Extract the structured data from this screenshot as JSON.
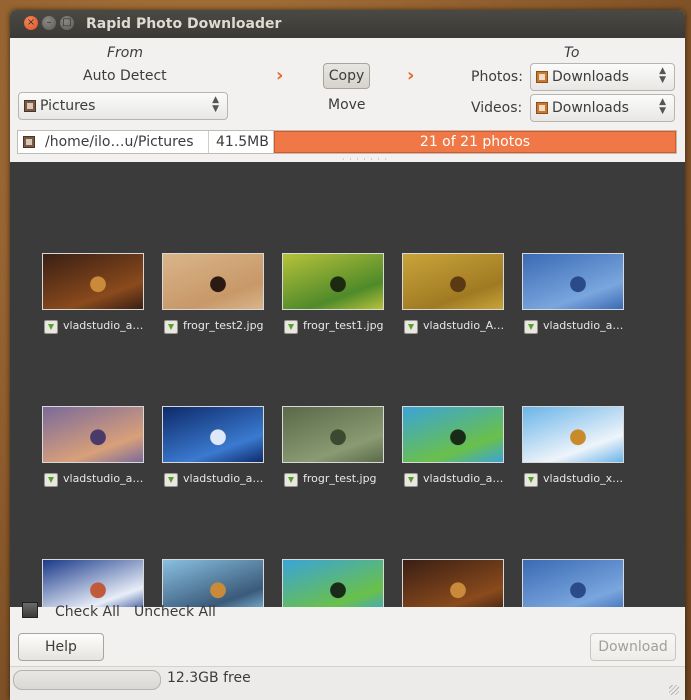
{
  "window": {
    "title": "Rapid Photo Downloader"
  },
  "source": {
    "from_label": "From",
    "auto_detect": "Auto Detect",
    "selected": "Pictures",
    "path": "/home/ilo…u/Pictures",
    "size": "41.5MB"
  },
  "transfer": {
    "copy_label": "Copy",
    "move_label": "Move",
    "arrow": "›"
  },
  "destination": {
    "to_label": "To",
    "photos_label": "Photos:",
    "photos_value": "Downloads",
    "videos_label": "Videos:",
    "videos_value": "Downloads"
  },
  "progress": {
    "label": "21 of 21 photos",
    "fraction": 1.0
  },
  "thumbnails": [
    {
      "name": "vladstudio_a…",
      "colors": [
        "#3a1f14",
        "#8a4a1c",
        "#c98a3a"
      ]
    },
    {
      "name": "frogr_test2.jpg",
      "colors": [
        "#d9b58a",
        "#c89868",
        "#2a1a12"
      ]
    },
    {
      "name": "frogr_test1.jpg",
      "colors": [
        "#b7c23a",
        "#4f8a2a",
        "#1c2a10"
      ]
    },
    {
      "name": "vladstudio_A…",
      "colors": [
        "#c9a43a",
        "#a07a22",
        "#5a3a12"
      ]
    },
    {
      "name": "vladstudio_a…",
      "colors": [
        "#3a6ab4",
        "#7aa6de",
        "#2a4a8a"
      ]
    },
    {
      "name": "vladstudio_a…",
      "colors": [
        "#7a6a9a",
        "#d9a07a",
        "#4a3a6a"
      ]
    },
    {
      "name": "vladstudio_a…",
      "colors": [
        "#0e2a6a",
        "#3a7ad0",
        "#dfe8f8"
      ]
    },
    {
      "name": "frogr_test.jpg",
      "colors": [
        "#5a6a4a",
        "#8a9a72",
        "#3a4a30"
      ]
    },
    {
      "name": "vladstudio_a…",
      "colors": [
        "#3aa4d8",
        "#6ac04a",
        "#1a2a18"
      ]
    },
    {
      "name": "vladstudio_x…",
      "colors": [
        "#6ab4e8",
        "#eef4fa",
        "#c98a2a"
      ]
    },
    {
      "name": "",
      "colors": [
        "#1a3a8a",
        "#e8eef8",
        "#c05a3a"
      ]
    },
    {
      "name": "",
      "colors": [
        "#8ac0e0",
        "#3a5a7a",
        "#c98a3a"
      ]
    },
    {
      "name": "",
      "colors": [
        "#3aa4d8",
        "#6ac04a",
        "#1a2a18"
      ]
    },
    {
      "name": "",
      "colors": [
        "#3a1f14",
        "#8a4a1c",
        "#c98a3a"
      ]
    },
    {
      "name": "",
      "colors": [
        "#3a6ab4",
        "#7aa6de",
        "#2a4a8a"
      ]
    }
  ],
  "selection": {
    "check_all": "Check All",
    "uncheck_all": "Uncheck All"
  },
  "buttons": {
    "help": "Help",
    "download": "Download"
  },
  "status": {
    "free_space": "12.3GB free"
  }
}
